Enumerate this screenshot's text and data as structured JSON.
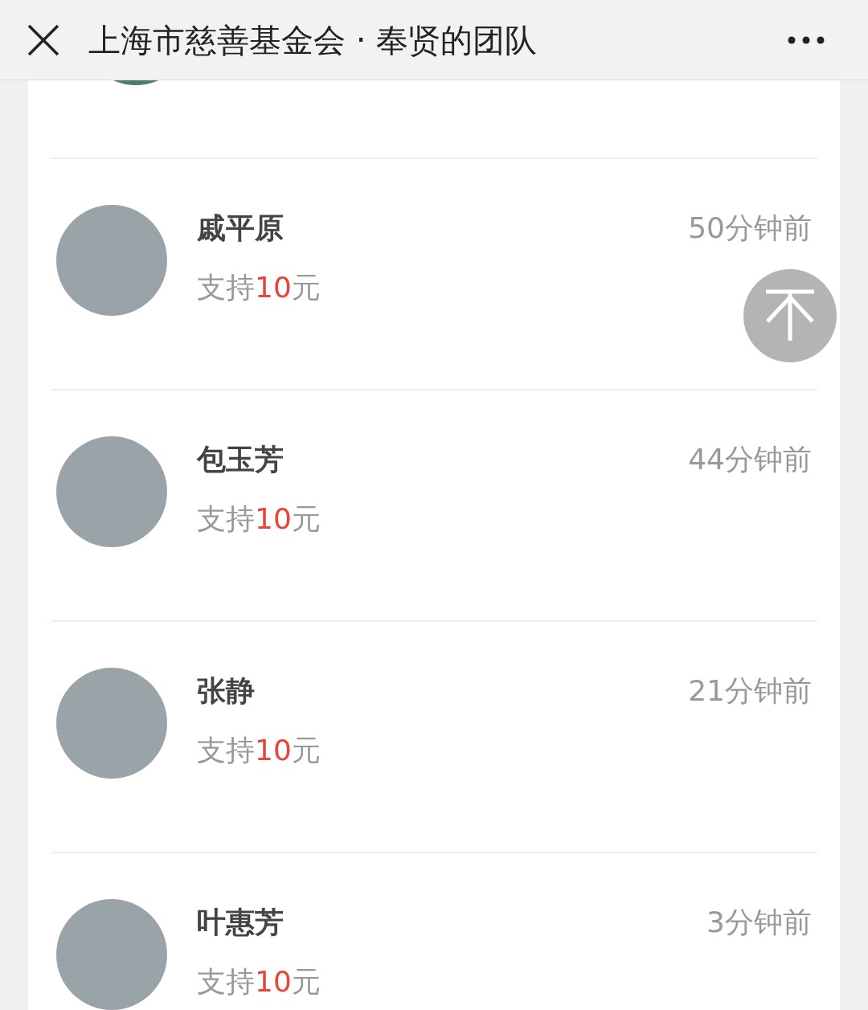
{
  "header": {
    "title": "上海市慈善基金会 · 奉贤的团队"
  },
  "donations": [
    {
      "name": "戚平原",
      "time": "50分钟前",
      "support": {
        "prefix": "支持",
        "amount": "10",
        "suffix": "元"
      }
    },
    {
      "name": "包玉芳",
      "time": "44分钟前",
      "support": {
        "prefix": "支持",
        "amount": "10",
        "suffix": "元"
      }
    },
    {
      "name": "张静",
      "time": "21分钟前",
      "support": {
        "prefix": "支持",
        "amount": "10",
        "suffix": "元"
      }
    },
    {
      "name": "叶惠芳",
      "time": "3分钟前",
      "support": {
        "prefix": "支持",
        "amount": "10",
        "suffix": "元"
      }
    }
  ]
}
